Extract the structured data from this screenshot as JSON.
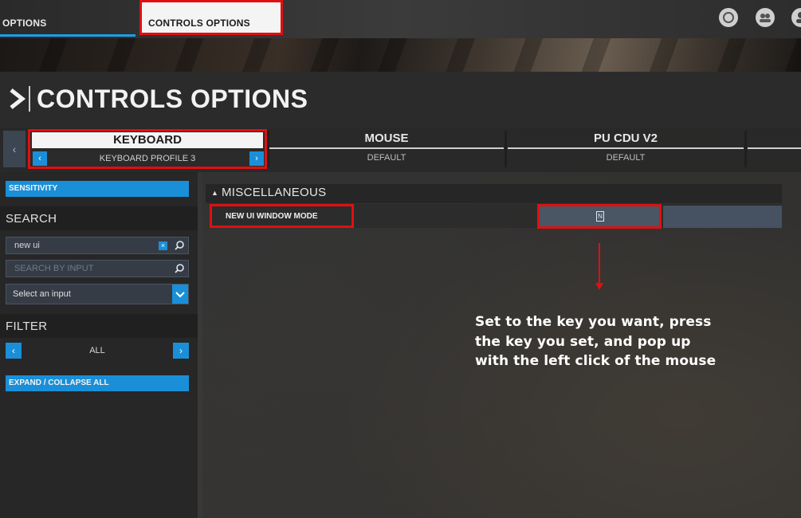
{
  "top_tabs": [
    {
      "label": "OPTIONS"
    },
    {
      "label": "CONTROLS OPTIONS"
    }
  ],
  "page_title": "CONTROLS OPTIONS",
  "device_tabs": [
    {
      "name": "KEYBOARD",
      "profile": "KEYBOARD PROFILE 3"
    },
    {
      "name": "MOUSE",
      "profile": "DEFAULT"
    },
    {
      "name": "PU CDU V2",
      "profile": "DEFAULT"
    }
  ],
  "sidebar": {
    "sensitivity_label": "SENSITIVITY",
    "search_heading": "SEARCH",
    "search_value": "new ui",
    "search_by_input_placeholder": "SEARCH BY INPUT",
    "select_input_label": "Select an input",
    "filter_heading": "FILTER",
    "filter_value": "ALL",
    "expand_collapse_label": "EXPAND / COLLAPSE ALL"
  },
  "main": {
    "category": "MISCELLANEOUS",
    "binding_name": "NEW UI WINDOW MODE",
    "binding_key": "N"
  },
  "annotation": {
    "line1": "Set to the key you want, press",
    "line2": "the key you set, and pop up",
    "line3": "with the left click of the mouse"
  },
  "colors": {
    "accent_blue": "#1a8fd8",
    "highlight_red": "#e01010"
  },
  "icons": [
    "chevron-right-icon",
    "user-icon",
    "group-icon",
    "search-icon",
    "chevron-left-icon",
    "chevron-down-icon",
    "clear-icon",
    "key-icon",
    "caret-up-icon"
  ]
}
